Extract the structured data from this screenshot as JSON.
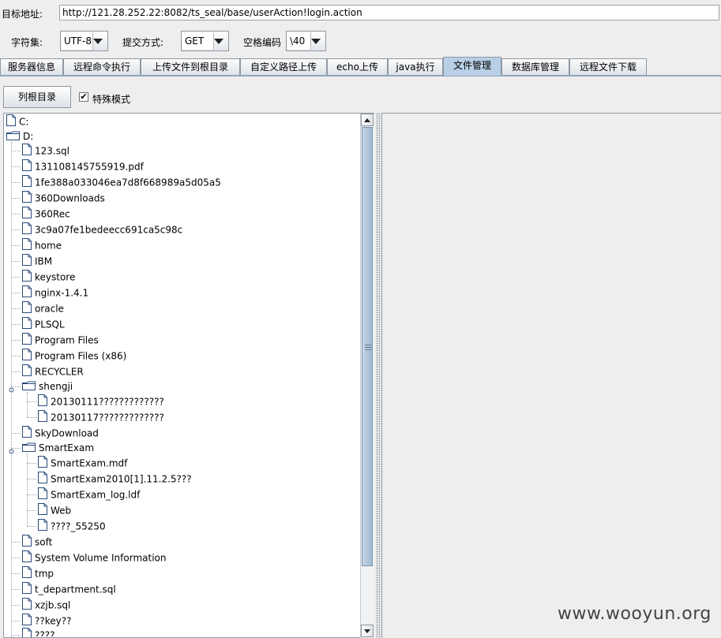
{
  "target": {
    "label": "目标地址:",
    "url": "http://121.28.252.22:8082/ts_seal/base/userAction!login.action"
  },
  "options": {
    "charset_label": "字符集:",
    "charset_value": "UTF-8",
    "method_label": "提交方式:",
    "method_value": "GET",
    "space_label": "空格编码",
    "space_value": "\\40"
  },
  "tabs": [
    {
      "label": "服务器信息"
    },
    {
      "label": "远程命令执行"
    },
    {
      "label": "上传文件到根目录"
    },
    {
      "label": "自定义路径上传"
    },
    {
      "label": "echo上传"
    },
    {
      "label": "java执行"
    },
    {
      "label": "文件管理",
      "active": true
    },
    {
      "label": "数据库管理"
    },
    {
      "label": "远程文件下载"
    }
  ],
  "toolbar": {
    "list_root_label": "列根目录",
    "special_mode_label": "特殊模式",
    "special_mode_checked": "✔"
  },
  "tree": [
    {
      "label": "C:",
      "level": 0,
      "type": "file"
    },
    {
      "label": "D:",
      "level": 0,
      "type": "folder"
    },
    {
      "label": "123.sql",
      "level": 1,
      "type": "file"
    },
    {
      "label": "131108145755919.pdf",
      "level": 1,
      "type": "file"
    },
    {
      "label": "1fe388a033046ea7d8f668989a5d05a5",
      "level": 1,
      "type": "file"
    },
    {
      "label": "360Downloads",
      "level": 1,
      "type": "file"
    },
    {
      "label": "360Rec",
      "level": 1,
      "type": "file"
    },
    {
      "label": "3c9a07fe1bedeecc691ca5c98c",
      "level": 1,
      "type": "file"
    },
    {
      "label": "home",
      "level": 1,
      "type": "file"
    },
    {
      "label": "IBM",
      "level": 1,
      "type": "file"
    },
    {
      "label": "keystore",
      "level": 1,
      "type": "file"
    },
    {
      "label": "nginx-1.4.1",
      "level": 1,
      "type": "file"
    },
    {
      "label": "oracle",
      "level": 1,
      "type": "file"
    },
    {
      "label": "PLSQL",
      "level": 1,
      "type": "file"
    },
    {
      "label": "Program Files",
      "level": 1,
      "type": "file"
    },
    {
      "label": "Program Files (x86)",
      "level": 1,
      "type": "file"
    },
    {
      "label": "RECYCLER",
      "level": 1,
      "type": "file"
    },
    {
      "label": "shengji",
      "level": 1,
      "type": "folder"
    },
    {
      "label": "20130111?????????????",
      "level": 2,
      "type": "file"
    },
    {
      "label": "20130117?????????????",
      "level": 2,
      "type": "file"
    },
    {
      "label": "SkyDownload",
      "level": 1,
      "type": "file"
    },
    {
      "label": "SmartExam",
      "level": 1,
      "type": "folder"
    },
    {
      "label": "SmartExam.mdf",
      "level": 2,
      "type": "file"
    },
    {
      "label": "SmartExam2010[1].11.2.5???",
      "level": 2,
      "type": "file"
    },
    {
      "label": "SmartExam_log.ldf",
      "level": 2,
      "type": "file"
    },
    {
      "label": "Web",
      "level": 2,
      "type": "file"
    },
    {
      "label": "????_55250",
      "level": 2,
      "type": "file"
    },
    {
      "label": "soft",
      "level": 1,
      "type": "file"
    },
    {
      "label": "System Volume Information",
      "level": 1,
      "type": "file"
    },
    {
      "label": "tmp",
      "level": 1,
      "type": "file"
    },
    {
      "label": "t_department.sql",
      "level": 1,
      "type": "file"
    },
    {
      "label": "xzjb.sql",
      "level": 1,
      "type": "file"
    },
    {
      "label": "??key??",
      "level": 1,
      "type": "file"
    },
    {
      "label": "????",
      "level": 1,
      "type": "file"
    }
  ],
  "watermark": "www.wooyun.org"
}
